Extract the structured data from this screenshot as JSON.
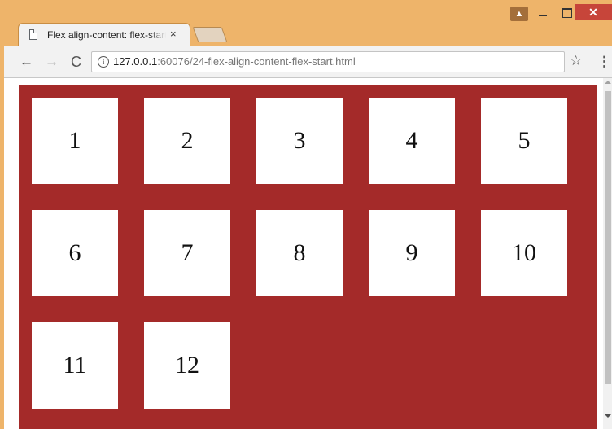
{
  "browser": {
    "tab_title": "Flex align-content: flex-start",
    "tab_close": "×",
    "url_host": "127.0.0.1",
    "url_rest": ":60076/24-flex-align-content-flex-start.html",
    "info_icon": "i",
    "back": "←",
    "forward": "→",
    "reload": "C",
    "star": "☆",
    "menu": "⋮",
    "profile": "▲",
    "close": "✕"
  },
  "icons": {
    "favicon": "page-icon",
    "info": "info-icon",
    "back": "arrow-left-icon",
    "forward": "arrow-right-icon",
    "reload": "reload-icon",
    "star": "star-icon",
    "menu": "kebab-menu-icon"
  },
  "colors": {
    "frame": "#EEB46A",
    "container": "#A42A29",
    "item": "#FFFFFF"
  },
  "page": {
    "items": [
      "1",
      "2",
      "3",
      "4",
      "5",
      "6",
      "7",
      "8",
      "9",
      "10",
      "11",
      "12"
    ]
  }
}
